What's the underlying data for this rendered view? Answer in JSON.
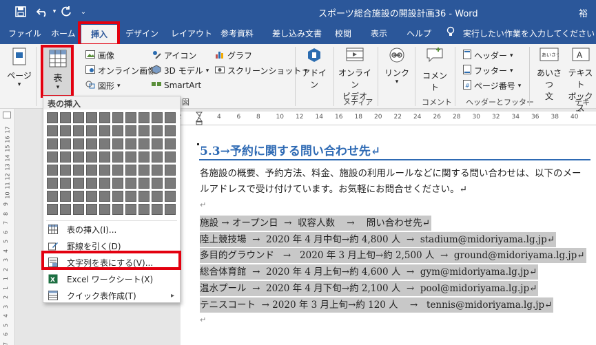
{
  "window": {
    "title": "スポーツ総合施設の開設計画36 - Word",
    "user": "裕"
  },
  "quick_access": {
    "save_icon": "save-icon",
    "undo_icon": "undo-icon",
    "redo_icon": "redo-icon",
    "customize_icon": "customize-icon"
  },
  "tabs": [
    "ファイル",
    "ホーム",
    "挿入",
    "デザイン",
    "レイアウト",
    "参考資料",
    "差し込み文書",
    "校閲",
    "表示",
    "ヘルプ"
  ],
  "active_tab": "挿入",
  "tell_me": "実行したい作業を入力してください",
  "ribbon": {
    "pages": "ページ",
    "table": "表",
    "pictures": "画像",
    "online_pictures": "オンライン画像",
    "shapes": "図形",
    "icons": "アイコン",
    "models_3d": "3D モデル",
    "smartart": "SmartArt",
    "chart": "グラフ",
    "screenshot": "スクリーンショット",
    "addins_1": "アドイ",
    "addins_2": "ン",
    "online_video_1": "オンライン",
    "online_video_2": "ビデオ",
    "link": "リンク",
    "comment": "コメント",
    "header": "ヘッダー",
    "footer": "フッター",
    "page_number": "ページ番号",
    "greeting_1": "あいさつ",
    "greeting_2": "文",
    "textbox_1": "テキスト",
    "textbox_2": "ボックス",
    "group_illust_tail": "図",
    "group_media": "メディア",
    "group_comment": "コメント",
    "group_header_footer": "ヘッダーとフッター",
    "group_text": "テキス"
  },
  "dropdown": {
    "title": "表の挿入",
    "grid_cols": 10,
    "grid_rows": 8,
    "items": [
      {
        "label": "表の挿入(I)...",
        "icon": "table-icon"
      },
      {
        "label": "罫線を引く(D)",
        "icon": "pencil-icon"
      },
      {
        "label": "文字列を表にする(V)...",
        "icon": "convert-text-icon"
      },
      {
        "label": "Excel ワークシート(X)",
        "icon": "excel-icon"
      },
      {
        "label": "クイック表作成(T)",
        "icon": "quick-table-icon"
      }
    ]
  },
  "ruler": {
    "h_labels": [
      "2",
      "2",
      "4",
      "6",
      "8",
      "10",
      "12",
      "14",
      "16",
      "18",
      "20",
      "22",
      "24",
      "26",
      "28",
      "30",
      "32",
      "34",
      "36",
      "38",
      "40"
    ],
    "v_labels": [
      "17",
      "16",
      "15",
      "14",
      "13",
      "12",
      "11",
      "10",
      "9",
      "8",
      "7",
      "6",
      "5",
      "4",
      "3",
      "2",
      "1",
      "1",
      "2",
      "3",
      "4",
      "5",
      "6",
      "7"
    ]
  },
  "document": {
    "heading": "5.3→予約に関する問い合わせ先↵",
    "paragraph_line1": "各施設の概要、予約方法、料金、施設の利用ルールなどに関する問い合わせは、以下のメー",
    "paragraph_line2": "ルアドレスで受け付けています。お気軽にお問合せください。↵",
    "empty_mark": "↵",
    "lines": [
      "施設 → オープン日  →  収容人数    →    問い合わせ先↵",
      "陸上競技場  →  2020 年 4 月中旬→約 4,800 人  →  stadium@midoriyama.lg.jp↵",
      "多目的グラウンド   →   2020 年 3 月上旬→約 2,500 人  →  ground@midoriyama.lg.jp↵",
      "総合体育館  →  2020 年 4 月上旬→約 4,600 人  →  gym@midoriyama.lg.jp↵",
      "温水プール  →  2020 年 4 月下旬→約 2,100 人  →  pool@midoriyama.lg.jp↵",
      "テニスコート  → 2020 年 3 月上旬→約 120 人    →   tennis@midoriyama.lg.jp↵"
    ],
    "end_mark": "↵"
  },
  "colors": {
    "title_bar": "#2b579a",
    "heading": "#2e6ab4",
    "highlight_box": "#e3000f",
    "selection": "#c8c8c8"
  }
}
